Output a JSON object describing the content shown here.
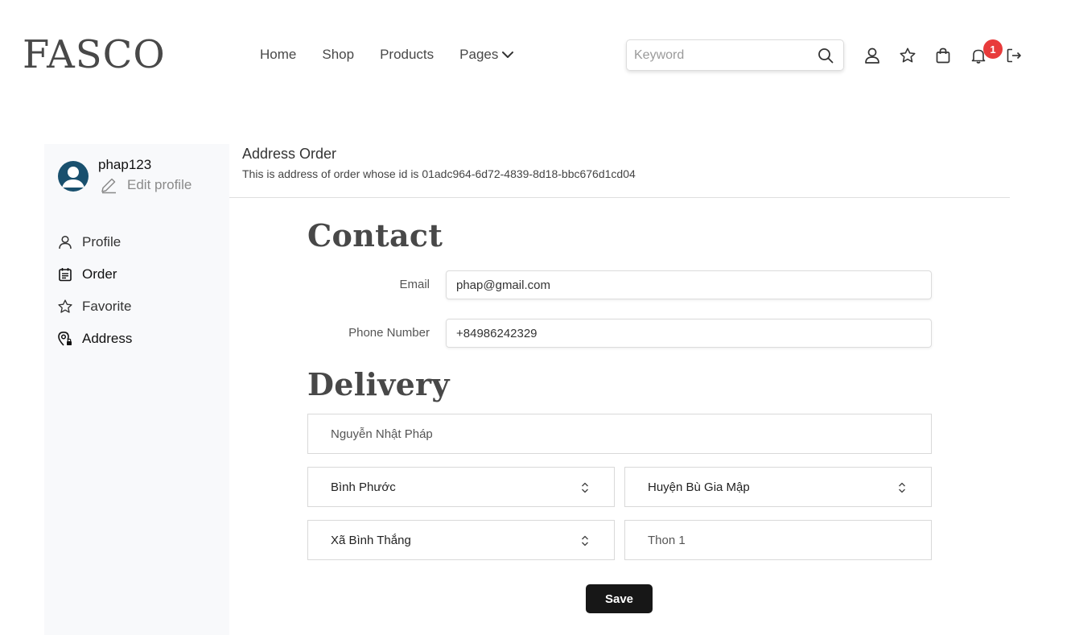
{
  "brand": {
    "logo": "FASCO"
  },
  "nav": {
    "home": "Home",
    "shop": "Shop",
    "products": "Products",
    "pages": "Pages"
  },
  "search": {
    "placeholder": "Keyword",
    "value": ""
  },
  "header_icons": [
    "search-icon",
    "user-icon",
    "star-icon",
    "bag-icon",
    "bell-icon",
    "logout-icon"
  ],
  "notifications": {
    "count": "1",
    "color": "#e83b3b"
  },
  "sidebar": {
    "username": "phap123",
    "edit_profile": "Edit profile",
    "items": [
      {
        "label": "Profile",
        "icon": "user-icon"
      },
      {
        "label": "Order",
        "icon": "calendar-list-icon"
      },
      {
        "label": "Favorite",
        "icon": "star-icon"
      },
      {
        "label": "Address",
        "icon": "location-pin-icon"
      }
    ]
  },
  "main": {
    "title": "Address Order",
    "subtitle": "This is address of order whose id is 01adc964-6d72-4839-8d18-bbc676d1cd04"
  },
  "contact": {
    "heading": "Contact",
    "email_label": "Email",
    "email_value": "phap@gmail.com",
    "phone_label": "Phone Number",
    "phone_value": "+84986242329"
  },
  "delivery": {
    "heading": "Delivery",
    "name": "Nguyễn Nhật Pháp",
    "province": "Bình Phước",
    "district": "Huyện Bù Gia Mập",
    "ward": "Xã Bình Thắng",
    "street": "Thon 1"
  },
  "actions": {
    "save": "Save"
  },
  "colors": {
    "primary": "#171717",
    "sidebar_bg": "#f8f9fb",
    "avatar": "#19506e",
    "badge": "#e83b3b"
  }
}
